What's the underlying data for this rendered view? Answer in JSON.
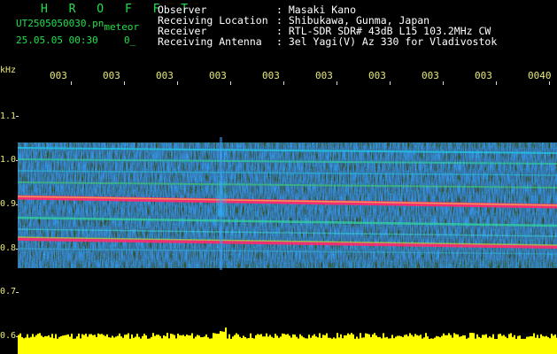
{
  "header": {
    "brand": "H R O F F T",
    "filename": "UT2505050030.pn",
    "tag": "meteor",
    "datetime": "25.05.05 00:30",
    "counter": "0_"
  },
  "info": {
    "observer_label": "Observer",
    "observer_value": ": Masaki Kano",
    "location_label": "Receiving Location",
    "location_value": ": Shibukawa, Gunma, Japan",
    "receiver_label": "Receiver",
    "receiver_value": ": RTL-SDR SDR# 43dB L15 103.2MHz CW",
    "antenna_label": "Receiving Antenna",
    "antenna_value": ": 3el Yagi(V) Az 330 for Vladivostok"
  },
  "axes": {
    "y_unit": "kHz",
    "y_ticks": [
      "1.1",
      "1.0",
      "0.9",
      "0.8",
      "0.7",
      "0.6"
    ],
    "x_ticks": [
      "003",
      "003",
      "003",
      "003",
      "003",
      "003",
      "003",
      "003",
      "003",
      "0040"
    ]
  },
  "colors": {
    "background": "#000000",
    "label_green": "#22e04a",
    "tick_yellow": "#e8e87a",
    "spectrum_blue": "#1a2aa8",
    "echo_red": "#ff2266",
    "power_bar": "#ffff00"
  }
}
